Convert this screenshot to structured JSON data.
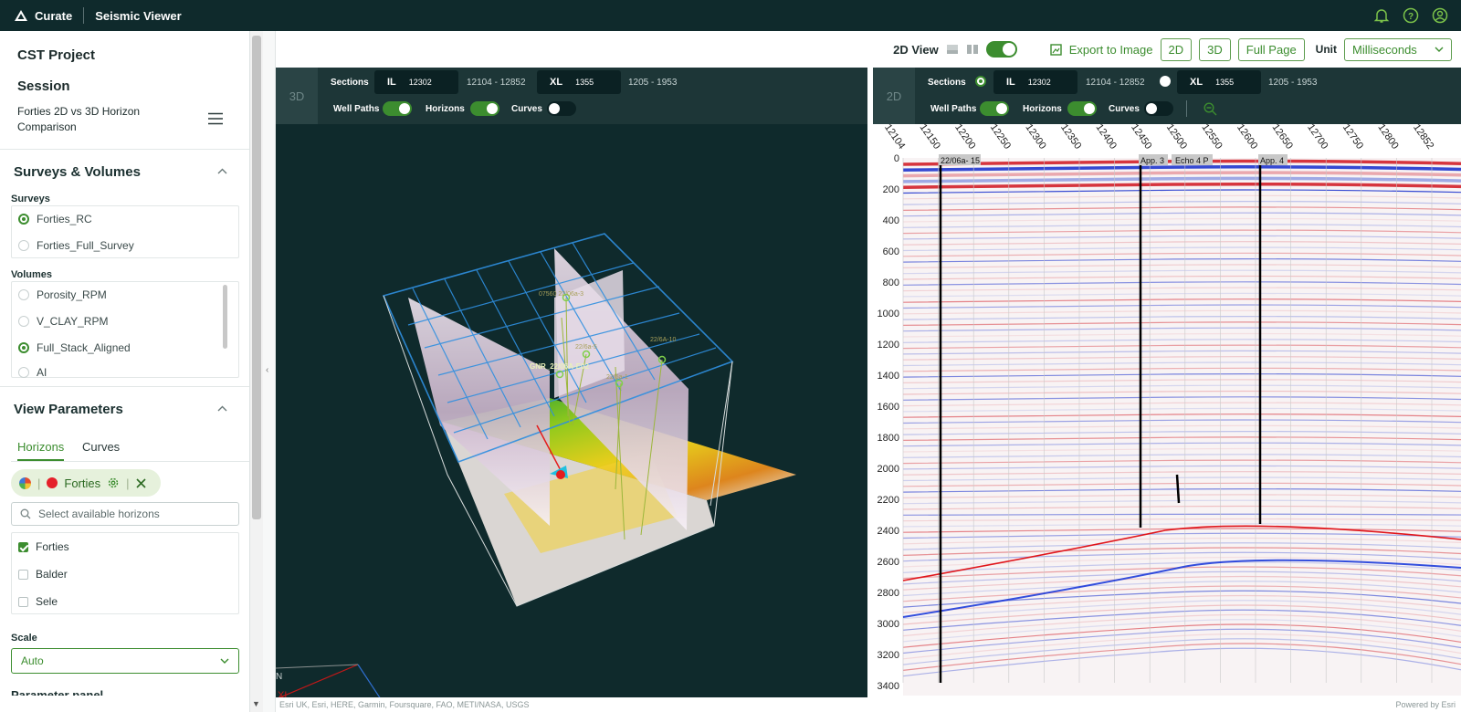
{
  "app": {
    "brand": "Curate",
    "title": "Seismic Viewer"
  },
  "sidebar": {
    "project": "CST Project",
    "session_heading": "Session",
    "session_name_line1": "Forties 2D vs 3D Horizon",
    "session_name_line2": "Comparison",
    "surveys_volumes": {
      "heading": "Surveys & Volumes",
      "surveys_label": "Surveys",
      "surveys": [
        {
          "name": "Forties_RC",
          "selected": true
        },
        {
          "name": "Forties_Full_Survey",
          "selected": false
        }
      ],
      "volumes_label": "Volumes",
      "volumes": [
        {
          "name": "Porosity_RPM",
          "selected": false
        },
        {
          "name": "V_CLAY_RPM",
          "selected": false
        },
        {
          "name": "Full_Stack_Aligned",
          "selected": true
        },
        {
          "name": "AI",
          "selected": false
        }
      ]
    },
    "view_parameters": {
      "heading": "View Parameters",
      "tabs": [
        "Horizons",
        "Curves"
      ],
      "active_tab": "Horizons",
      "chip_label": "Forties",
      "search_placeholder": "Select available horizons",
      "horizons": [
        {
          "name": "Forties",
          "checked": true
        },
        {
          "name": "Balder",
          "checked": false
        },
        {
          "name": "Sele",
          "checked": false
        }
      ],
      "scale_label": "Scale",
      "scale_value": "Auto",
      "cut_text": "Parameter panel"
    }
  },
  "toolbar": {
    "view_label": "2D View",
    "export_label": "Export to Image",
    "btn_2d": "2D",
    "btn_3d": "3D",
    "btn_full": "Full Page",
    "unit_label": "Unit",
    "unit_value": "Milliseconds"
  },
  "panel3d": {
    "badge": "3D",
    "sections_label": "Sections",
    "il_label": "IL",
    "il_value": "12302",
    "il_range": "12104 - 12852",
    "xl_label": "XL",
    "xl_value": "1355",
    "xl_range": "1205 - 1953",
    "well_paths": "Well Paths",
    "horizons": "Horizons",
    "curves": "Curves",
    "well_labels": [
      "GNR_22/06A-E02",
      "07560 22/06a-3",
      "22/6a-5",
      "22/6A-10",
      "22/6a-1"
    ],
    "axis_xl": "XL",
    "axis_il": "IL",
    "axis_n": "N"
  },
  "panel2d": {
    "badge": "2D",
    "sections_label": "Sections",
    "il_label": "IL",
    "il_value": "12302",
    "il_range": "12104 - 12852",
    "xl_label": "XL",
    "xl_value": "1355",
    "xl_range": "1205 - 1953",
    "well_paths": "Well Paths",
    "horizons": "Horizons",
    "curves": "Curves",
    "x_ticks": [
      "12104",
      "12150",
      "12200",
      "12250",
      "12300",
      "12350",
      "12400",
      "12450",
      "12500",
      "12550",
      "12600",
      "12650",
      "12700",
      "12750",
      "12800",
      "12852"
    ],
    "y_ticks": [
      "0",
      "200",
      "400",
      "600",
      "800",
      "1000",
      "1200",
      "1400",
      "1600",
      "1800",
      "2000",
      "2200",
      "2400",
      "2600",
      "2800",
      "3000",
      "3200",
      "3400"
    ],
    "well_tags": [
      "22/06a- 15",
      "App. 3",
      "Echo 4 P",
      "App. 4"
    ]
  },
  "footer": {
    "attribution": "Esri UK, Esri, HERE, Garmin, Foursquare, FAO, METI/NASA, USGS",
    "powered": "Powered by Esri"
  },
  "colors": {
    "accent": "#3c8d2f",
    "dark_bg": "#0f2a2c",
    "panel_header": "#1d3637"
  }
}
